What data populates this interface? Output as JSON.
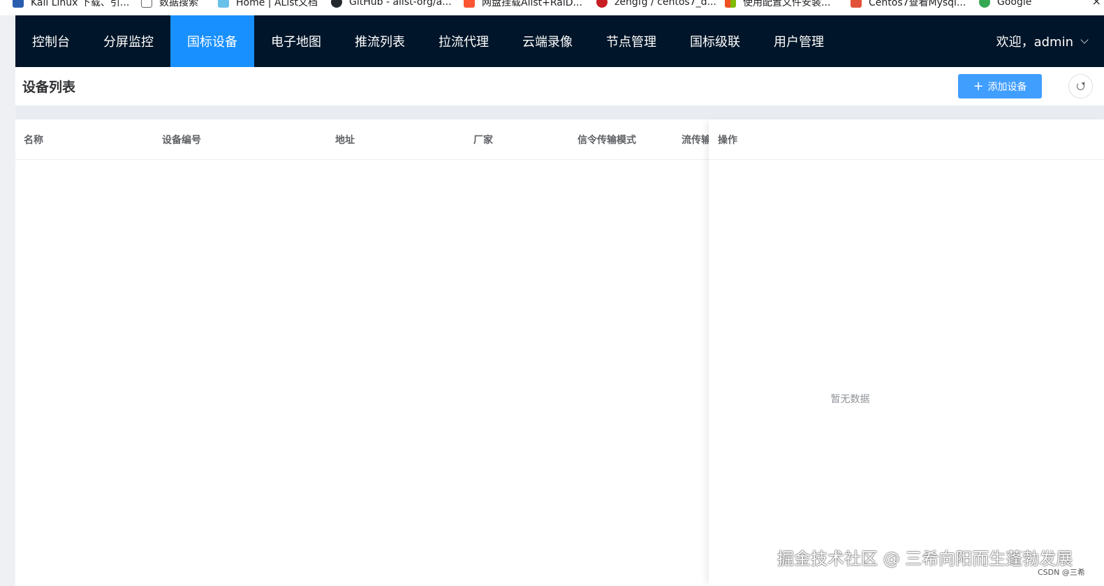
{
  "browser": {
    "bookmarks": [
      {
        "label": "Kali Linux 下载、引...",
        "icon": "kali-icon",
        "color": "#2a5db0"
      },
      {
        "label": "数据搜索",
        "icon": "page-icon",
        "color": "#5f6368"
      },
      {
        "label": "Home | AList文档",
        "icon": "alist-icon",
        "color": "#69c0e8"
      },
      {
        "label": "GitHub - alist-org/a...",
        "icon": "github-icon",
        "color": "#24292e"
      },
      {
        "label": "网盘挂载Alist+RaiD...",
        "icon": "csdn-icon",
        "color": "#fc5531"
      },
      {
        "label": "zengfg / centos7_d...",
        "icon": "gitee-icon",
        "color": "#c71d23"
      },
      {
        "label": "使用配置文件安装...",
        "icon": "microsoft-icon",
        "color": "#0078d4"
      },
      {
        "label": "Centos7查看Mysql...",
        "icon": "blog-icon",
        "color": "#e2523a"
      },
      {
        "label": "Google",
        "icon": "google-icon",
        "color": "#34a853"
      }
    ]
  },
  "header": {
    "nav": [
      {
        "label": "控制台",
        "active": false
      },
      {
        "label": "分屏监控",
        "active": false
      },
      {
        "label": "国标设备",
        "active": true
      },
      {
        "label": "电子地图",
        "active": false
      },
      {
        "label": "推流列表",
        "active": false
      },
      {
        "label": "拉流代理",
        "active": false
      },
      {
        "label": "云端录像",
        "active": false
      },
      {
        "label": "节点管理",
        "active": false
      },
      {
        "label": "国标级联",
        "active": false
      },
      {
        "label": "用户管理",
        "active": false
      }
    ],
    "user": "欢迎，admin",
    "colors": {
      "background": "#001529",
      "active": "#1890ff"
    }
  },
  "page": {
    "title": "设备列表",
    "add_button": "添加设备",
    "refresh_icon": "refresh-icon",
    "accent": "#409eff"
  },
  "table": {
    "columns": [
      "名称",
      "设备编号",
      "地址",
      "厂家",
      "信令传输模式",
      "流传输模式"
    ],
    "fixed_column": "操作",
    "empty_text": "暂无数据"
  },
  "watermark": {
    "text": "掘金技术社区 @ 三希向阳而生蓬勃发展",
    "csdn": "CSDN @三希"
  }
}
